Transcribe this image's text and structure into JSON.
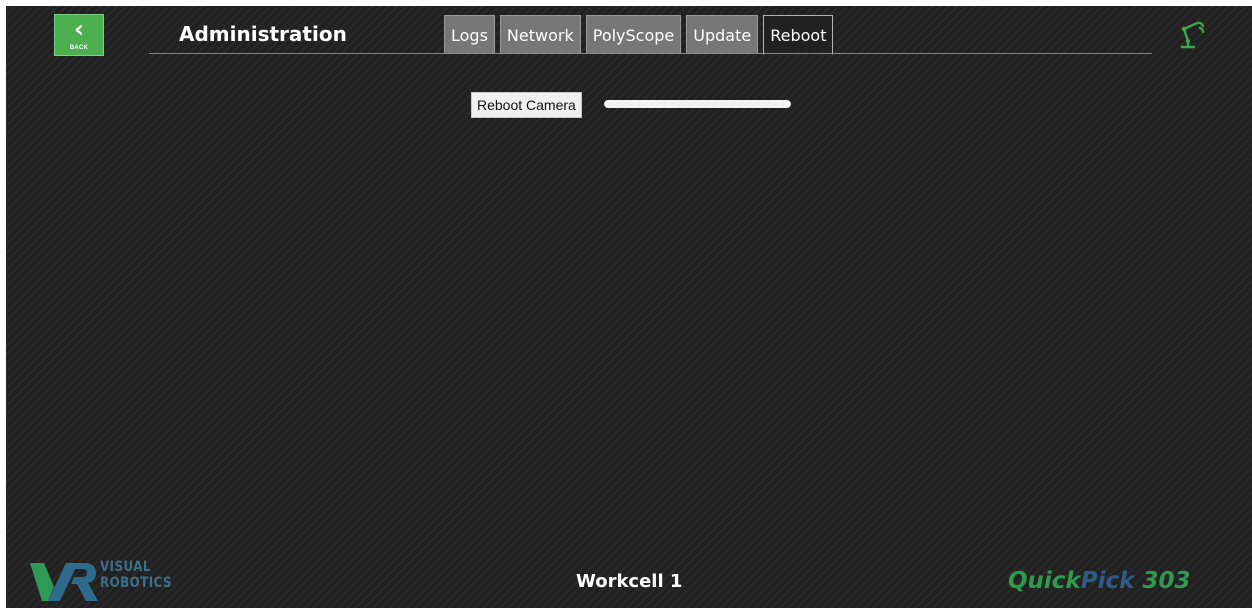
{
  "header": {
    "back_label": "BACK",
    "back_icon": "chevron-left-icon",
    "title": "Administration",
    "status_icon": "robot-arm-icon"
  },
  "tabs": [
    {
      "label": "Logs",
      "active": false
    },
    {
      "label": "Network",
      "active": false
    },
    {
      "label": "PolyScope",
      "active": false
    },
    {
      "label": "Update",
      "active": false
    },
    {
      "label": "Reboot",
      "active": true
    }
  ],
  "reboot": {
    "button_label": "Reboot Camera",
    "progress": 1.0
  },
  "footer": {
    "logo_line1": "VISUAL",
    "logo_line2": "ROBOTICS",
    "workcell": "Workcell 1",
    "brand_part1": "Quick",
    "brand_part2": "Pick",
    "brand_part3": "303"
  },
  "colors": {
    "background": "#212121",
    "accent_green": "#4caf50",
    "brand_green": "#2e9a4c",
    "brand_blue": "#2d5b8c",
    "tab_inactive": "#777777"
  }
}
